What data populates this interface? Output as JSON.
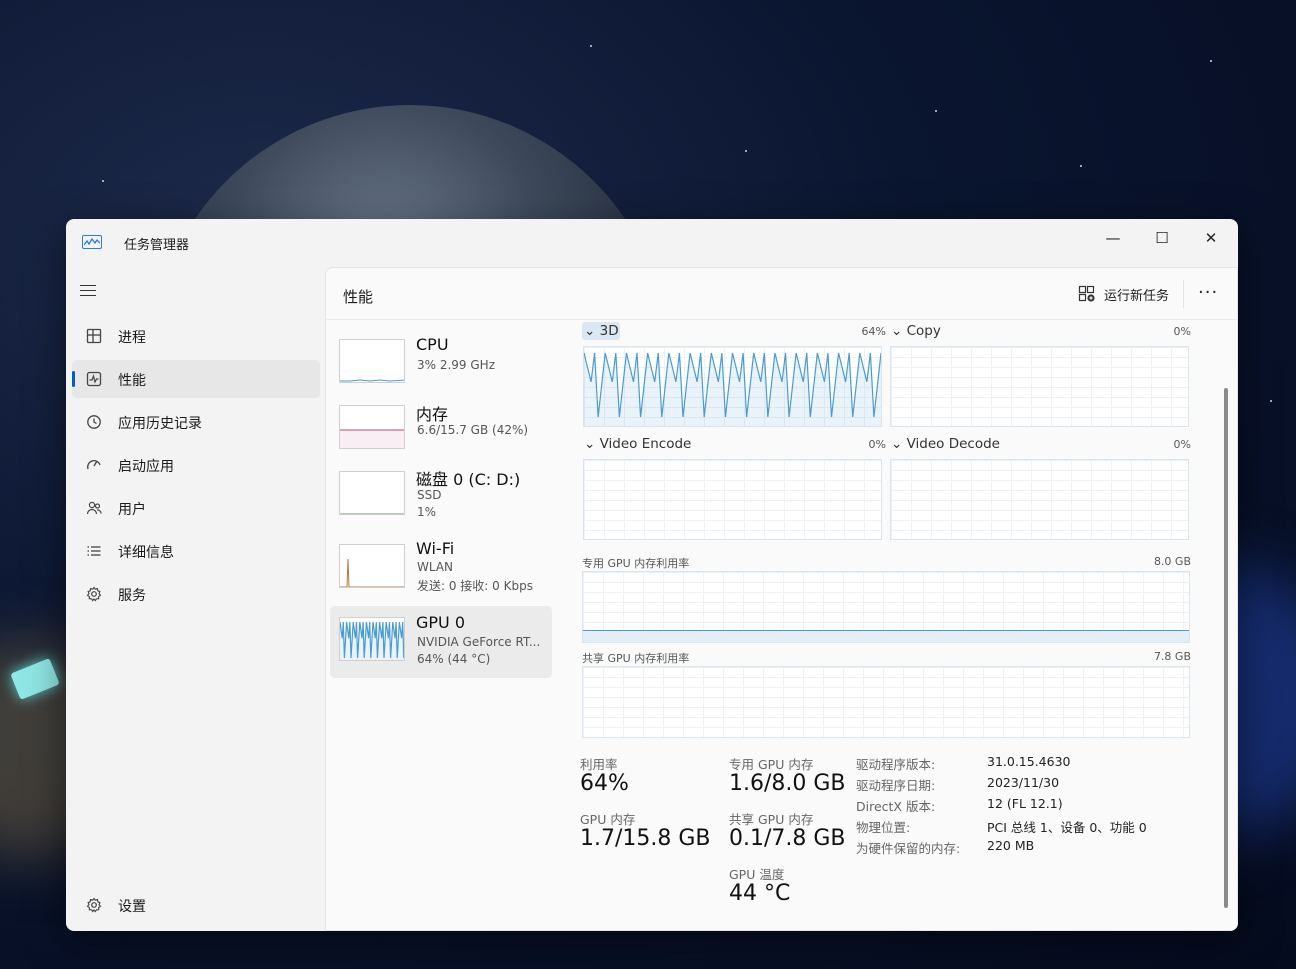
{
  "window": {
    "title": "任务管理器",
    "minimize": "—",
    "maximize": "☐",
    "close": "✕"
  },
  "sidebar": {
    "items": [
      {
        "label": "进程",
        "icon": "processes-icon"
      },
      {
        "label": "性能",
        "icon": "performance-icon",
        "active": true
      },
      {
        "label": "应用历史记录",
        "icon": "history-icon"
      },
      {
        "label": "启动应用",
        "icon": "startup-icon"
      },
      {
        "label": "用户",
        "icon": "users-icon"
      },
      {
        "label": "详细信息",
        "icon": "details-icon"
      },
      {
        "label": "服务",
        "icon": "services-icon"
      }
    ],
    "settings_label": "设置"
  },
  "header": {
    "title": "性能",
    "run_task": "运行新任务",
    "more": "···"
  },
  "devices": [
    {
      "name": "CPU",
      "line1": "3%  2.99 GHz",
      "line2": ""
    },
    {
      "name": "内存",
      "line1": "6.6/15.7 GB (42%)",
      "line2": ""
    },
    {
      "name": "磁盘 0 (C: D:)",
      "line1": "SSD",
      "line2": "1%"
    },
    {
      "name": "Wi-Fi",
      "line1": "WLAN",
      "line2": "发送: 0  接收: 0 Kbps"
    },
    {
      "name": "GPU 0",
      "line1": "NVIDIA GeForce RT...",
      "line2": "64%  (44 °C)",
      "active": true
    }
  ],
  "graphs": {
    "g3d": {
      "label": "3D",
      "pct": "64%"
    },
    "copy": {
      "label": "Copy",
      "pct": "0%"
    },
    "encode": {
      "label": "Video Encode",
      "pct": "0%"
    },
    "decode": {
      "label": "Video Decode",
      "pct": "0%"
    },
    "dedicated": {
      "label": "专用 GPU 内存利用率",
      "max": "8.0 GB"
    },
    "shared": {
      "label": "共享 GPU 内存利用率",
      "max": "7.8 GB"
    }
  },
  "stats": {
    "util_label": "利用率",
    "util_value": "64%",
    "gpumem_label": "GPU 内存",
    "gpumem_value": "1.7/15.8 GB",
    "ded_label": "专用 GPU 内存",
    "ded_value": "1.6/8.0 GB",
    "shared_label": "共享 GPU 内存",
    "shared_value": "0.1/7.8 GB",
    "temp_label": "GPU 温度",
    "temp_value": "44 °C"
  },
  "driver": [
    {
      "key": "驱动程序版本:",
      "value": "31.0.15.4630"
    },
    {
      "key": "驱动程序日期:",
      "value": "2023/11/30"
    },
    {
      "key": "DirectX 版本:",
      "value": "12 (FL 12.1)"
    },
    {
      "key": "物理位置:",
      "value": "PCI 总线 1、设备 0、功能 0"
    },
    {
      "key": "为硬件保留的内存:",
      "value": "220 MB"
    }
  ],
  "colors": {
    "accent": "#005fb8",
    "gpu_line": "#4a9bd1",
    "memory_line": "#b0507a"
  }
}
